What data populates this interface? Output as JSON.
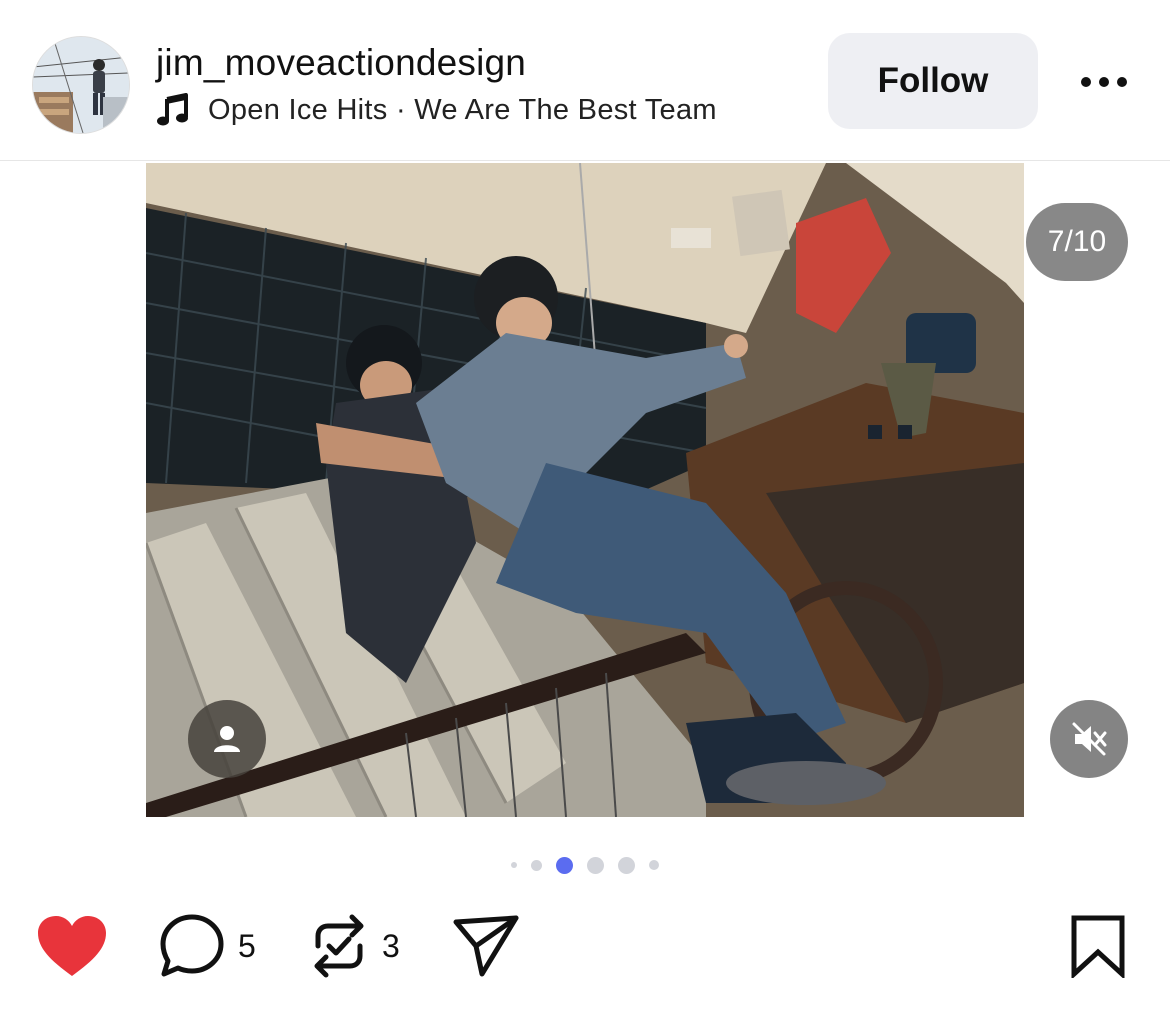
{
  "header": {
    "username": "jim_moveactiondesign",
    "music_icon": "music-note-icon",
    "music": "Open Ice Hits · We Are The Best Team",
    "follow_label": "Follow",
    "more_icon": "more-horizontal-icon"
  },
  "media": {
    "counter": "7/10",
    "tag_icon": "person-icon",
    "mute_icon": "volume-muted-icon",
    "carousel_active_dot": 3,
    "carousel_visible_dots": 6
  },
  "actions": {
    "like_icon": "heart-filled-icon",
    "like_color": "#e8343b",
    "comment_icon": "comment-bubble-icon",
    "comment_count": "5",
    "repost_icon": "repost-icon",
    "repost_count": "3",
    "share_icon": "send-icon",
    "save_icon": "bookmark-icon"
  },
  "colors": {
    "accent": "#5b6cf0",
    "follow_bg": "#eeeff3"
  }
}
